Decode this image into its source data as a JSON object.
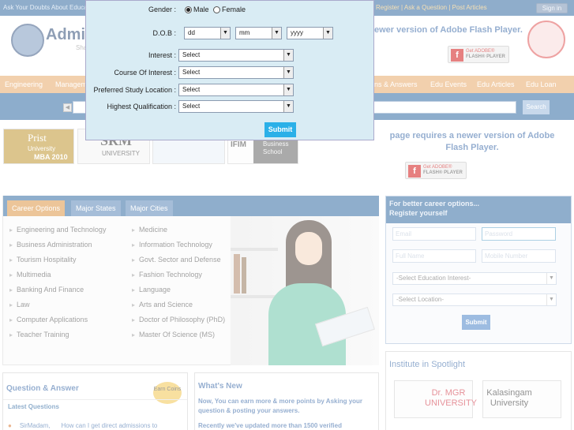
{
  "topbar": {
    "left_text": "Ask Your Doubts About Educa...",
    "right_text": "Register | Ask a Question | Post Articles",
    "signin_label": "Sign in"
  },
  "header": {
    "logo_text": "Admis",
    "logo_sub": "Sha",
    "flash_message": "ewer version of Adobe Flash Player.",
    "flash_get": "Get ADOBE®",
    "flash_player": "FLASH® PLAYER"
  },
  "orange_nav": [
    "Engineering",
    "Managem",
    "ns & Answers",
    "Edu Events",
    "Edu Articles",
    "Edu Loan"
  ],
  "search": {
    "button_label": "Search",
    "scroll_icon": "◀"
  },
  "banners": {
    "prist": {
      "title": "Prist",
      "line2": "University",
      "line3": "MBA 2010"
    },
    "srm": {
      "title": "SRM",
      "sub": "UNIVERSITY"
    },
    "ifim": {
      "abbr": "IFIM",
      "side": "Business School"
    }
  },
  "flash_message2": "page requires a newer version of Adobe Flash Player.",
  "career": {
    "tabs": [
      "Career Options",
      "Major States",
      "Major Cities"
    ],
    "left": [
      "Engineering and Technology",
      "Business Administration",
      "Tourism Hospitality",
      "Multimedia",
      "Banking And Finance",
      "Law",
      "Computer Applications",
      "Teacher Training"
    ],
    "right": [
      "Medicine",
      "Information Technology",
      "Govt. Sector and Defense",
      "Fashion Technology",
      "Language",
      "Arts and Science",
      "Doctor of Philosophy (PhD)",
      "Master Of Science (MS)"
    ]
  },
  "register": {
    "heading1": "For better career options...",
    "heading2": "Register yourself",
    "email_ph": "Email",
    "password_ph": "Password",
    "fullname_ph": "Full Name",
    "mobile_ph": "Mobile Number",
    "education_select": "-Select Education Interest-",
    "location_select": "-Select Location-",
    "submit": "Submit"
  },
  "qa": {
    "heading": "Question & Answer",
    "coins": "Earn Coins",
    "latest": "Latest Questions",
    "q1_user": "SirMadam,",
    "q1_text": "How can I get direct admissions to"
  },
  "whats_new": {
    "heading": "What's New",
    "p1": "Now, You can earn more & more points by Asking your question & posting your answers.",
    "p2": "Recently we've updated more than 1500 verified"
  },
  "spotlight": {
    "heading": "Institute in Spotlight",
    "inst1": "Dr. MGR UNIVERSITY",
    "inst2": "Kalasingam University"
  },
  "modal": {
    "gender_label": "Gender :",
    "male": "Male",
    "female": "Female",
    "dob_label": "D.O.B :",
    "dd": "dd",
    "mm": "mm",
    "yyyy": "yyyy",
    "interest_label": "Interest :",
    "course_label": "Course Of Interest :",
    "location_label": "Preferred Study Location :",
    "qualification_label": "Highest Qualification :",
    "select": "Select",
    "submit": "Submit"
  },
  "colors": {
    "nav_blue": "#1f5c99",
    "orange": "#e5a05a",
    "modal_bg": "#d9ecf4",
    "submit_blue": "#2bb0e8"
  }
}
